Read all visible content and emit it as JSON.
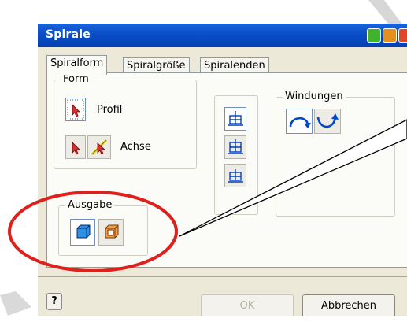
{
  "window": {
    "title": "Spirale"
  },
  "tabs": [
    {
      "label": "Spiralform",
      "active": true
    },
    {
      "label": "Spiralgröße",
      "active": false
    },
    {
      "label": "Spiralenden",
      "active": false
    }
  ],
  "groups": {
    "form": {
      "label": "Form",
      "profile_label": "Profil",
      "axis_label": "Achse"
    },
    "windings": {
      "label": "Windungen"
    },
    "output": {
      "label": "Ausgabe"
    }
  },
  "buttons": {
    "help": "?",
    "ok": "OK",
    "cancel": "Abbrechen"
  },
  "colors": {
    "title_bar": "#0a4ec8",
    "highlight_ellipse": "#e0201c",
    "face": "#ece9d8"
  },
  "icons": {
    "select_arrow": "select-arrow-icon",
    "axis": "axis-pick-icon",
    "solid_output": "solid-body-icon",
    "surface_output": "surface-body-icon",
    "align_first": "align-icon",
    "align_second": "align-icon",
    "align_third": "align-icon",
    "clockwise": "clockwise-icon",
    "counterclockwise": "counterclockwise-icon"
  }
}
